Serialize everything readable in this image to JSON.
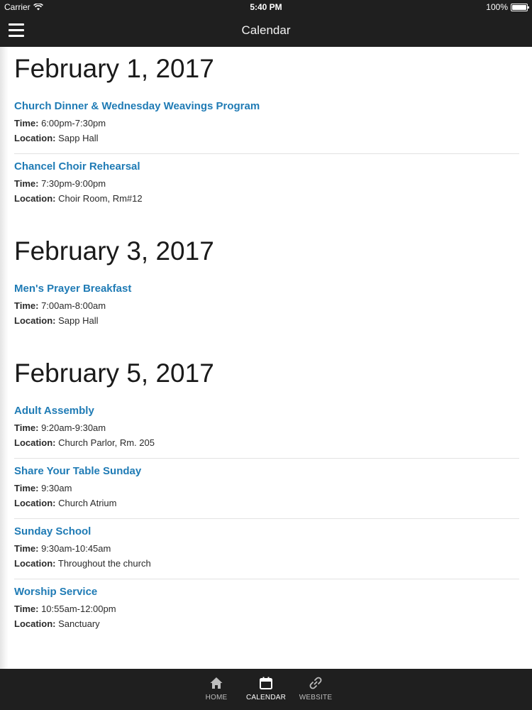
{
  "status_bar": {
    "carrier": "Carrier",
    "time": "5:40 PM",
    "battery": "100%"
  },
  "nav": {
    "title": "Calendar"
  },
  "days": [
    {
      "date": "February 1, 2017",
      "events": [
        {
          "title": "Church Dinner & Wednesday Weavings Program",
          "time": "6:00pm-7:30pm",
          "location": "Sapp Hall"
        },
        {
          "title": "Chancel Choir Rehearsal",
          "time": "7:30pm-9:00pm",
          "location": "Choir Room, Rm#12"
        }
      ]
    },
    {
      "date": "February 3, 2017",
      "events": [
        {
          "title": "Men's Prayer Breakfast",
          "time": "7:00am-8:00am",
          "location": "Sapp Hall"
        }
      ]
    },
    {
      "date": "February 5, 2017",
      "events": [
        {
          "title": "Adult Assembly",
          "time": "9:20am-9:30am",
          "location": "Church Parlor, Rm. 205"
        },
        {
          "title": "Share Your Table Sunday",
          "time": "9:30am",
          "location": "Church Atrium"
        },
        {
          "title": "Sunday School",
          "time": "9:30am-10:45am",
          "location": "Throughout the church"
        },
        {
          "title": "Worship Service",
          "time": "10:55am-12:00pm",
          "location": "Sanctuary"
        }
      ]
    }
  ],
  "labels": {
    "time": "Time:",
    "location": "Location:"
  },
  "tabs": [
    {
      "label": "HOME",
      "icon": "home-icon",
      "active": false
    },
    {
      "label": "CALENDAR",
      "icon": "calendar-icon",
      "active": true
    },
    {
      "label": "WEBSITE",
      "icon": "link-icon",
      "active": false
    }
  ],
  "colors": {
    "bar_background": "#1f1f1f",
    "event_title": "#1f7bb5"
  }
}
